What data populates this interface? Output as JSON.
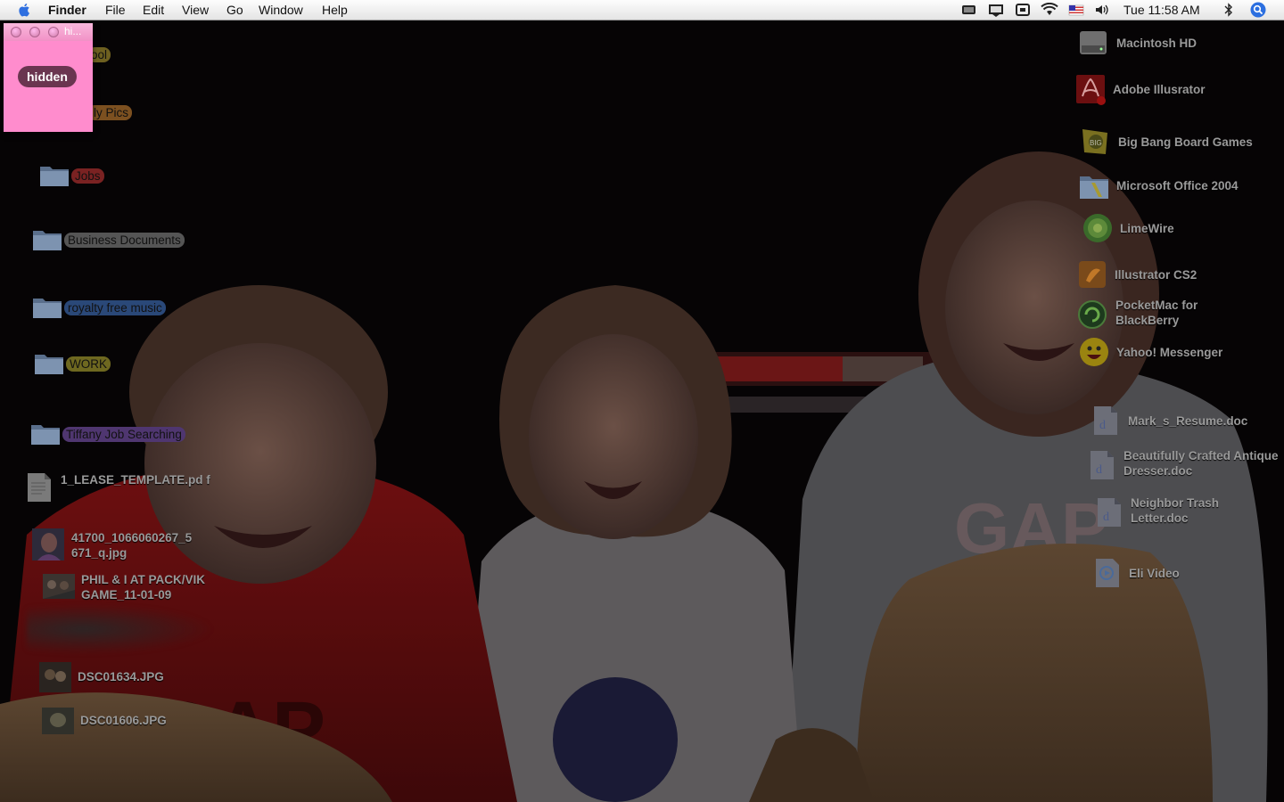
{
  "menubar": {
    "app_name": "Finder",
    "menus": [
      "File",
      "Edit",
      "View",
      "Go",
      "Window",
      "Help"
    ],
    "clock": "Tue 11:58 AM",
    "status_icons": [
      "battery-icon",
      "display-icon",
      "time-machine-icon",
      "wifi-icon",
      "flag-icon",
      "volume-icon",
      "bluetooth-icon",
      "spotlight-icon"
    ]
  },
  "sticky": {
    "title": "hi...",
    "button_label": "hidden",
    "color": "#ff8ccd"
  },
  "left_items": [
    {
      "label": "ool",
      "tag_color": "#8a7a26"
    },
    {
      "label": "ily Pics",
      "tag_color": "#8a5a20"
    },
    {
      "label": "Jobs",
      "tag_color": "#8c2b2b"
    },
    {
      "label": "Business Documents",
      "tag_color": "#5c5c5c"
    },
    {
      "label": "royalty free music",
      "tag_color": "#2b4a7c"
    },
    {
      "label": "WORK",
      "tag_color": "#7c7422"
    },
    {
      "label": "Tiffany Job Searching",
      "tag_color": "#5a3a78"
    },
    {
      "label": "1_LEASE_TEMPLATE.pd f"
    },
    {
      "label": "41700_1066060267_5 671_q.jpg"
    },
    {
      "label": "PHIL & I AT PACK/VIK GAME_11-01-09"
    },
    {
      "label": "DSC01634.JPG"
    },
    {
      "label": "DSC01606.JPG"
    }
  ],
  "right_items": [
    {
      "label": "Macintosh HD",
      "icon": "hard-drive-icon"
    },
    {
      "label": "Adobe Illusrator",
      "icon": "pdf-icon"
    },
    {
      "label": "Big Bang Board Games",
      "icon": "game-icon"
    },
    {
      "label": "Microsoft Office 2004",
      "icon": "folder-icon"
    },
    {
      "label": "LimeWire",
      "icon": "limewire-icon"
    },
    {
      "label": "Illustrator CS2",
      "icon": "illustrator-icon"
    },
    {
      "label": "PocketMac for BlackBerry",
      "icon": "pocketmac-icon"
    },
    {
      "label": "Yahoo! Messenger",
      "icon": "yahoo-icon"
    },
    {
      "label": "Mark_s_Resume.doc",
      "icon": "document-icon"
    },
    {
      "label": "Beautifully Crafted Antique Dresser.doc",
      "icon": "document-icon"
    },
    {
      "label": "Neighbor Trash Letter.doc",
      "icon": "document-icon"
    },
    {
      "label": "Eli Video",
      "icon": "video-icon"
    }
  ]
}
